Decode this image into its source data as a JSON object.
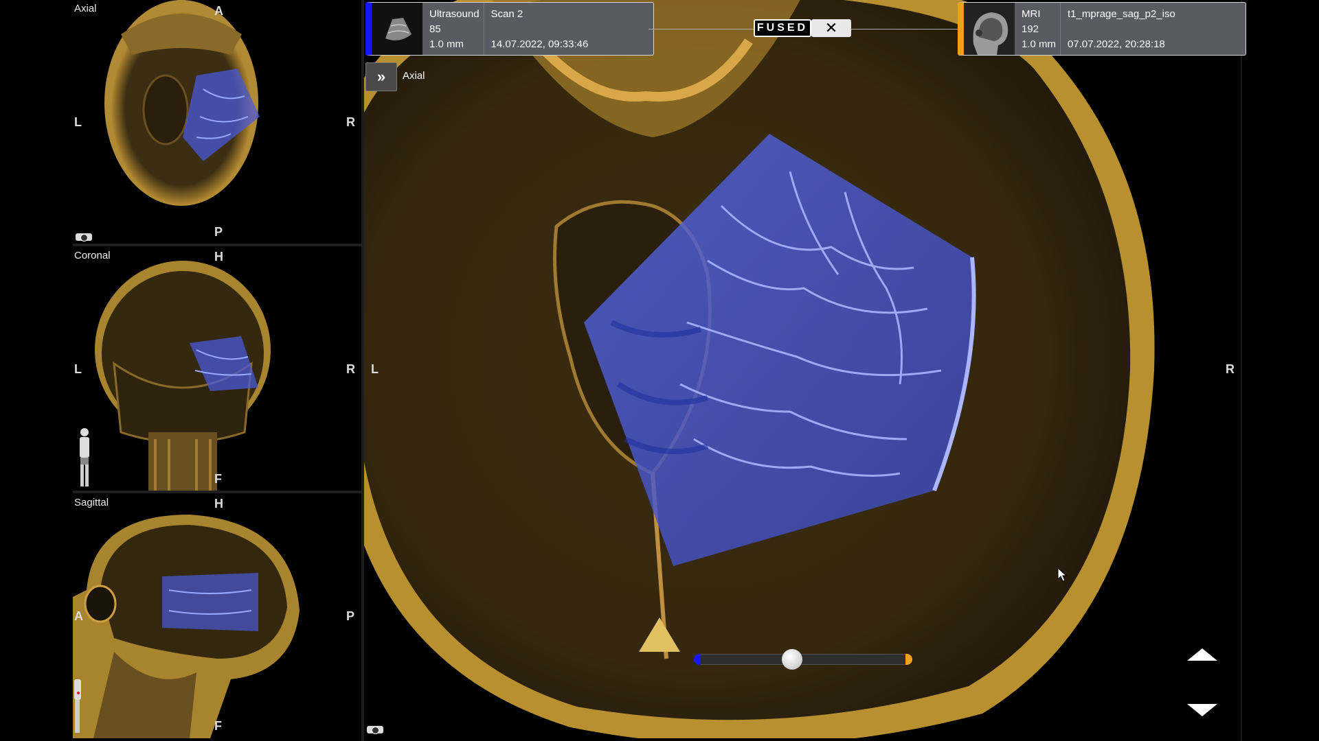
{
  "viewports": {
    "axial": {
      "title": "Axial",
      "top": "A",
      "bottom": "P",
      "left": "L",
      "right": "R"
    },
    "coronal": {
      "title": "Coronal",
      "top": "H",
      "bottom": "F",
      "left": "L",
      "right": "R"
    },
    "sagittal": {
      "title": "Sagittal",
      "top": "H",
      "bottom": "F",
      "left": "A",
      "right": "P"
    },
    "main": {
      "title": "Axial",
      "left": "L",
      "right": "R"
    }
  },
  "ultrasound_card": {
    "modality": "Ultrasound",
    "count": "85",
    "spacing": "1.0 mm",
    "name": "Scan 2",
    "datetime": "14.07.2022, 09:33:46",
    "accent_color": "#1616ff"
  },
  "mri_card": {
    "modality": "MRI",
    "count": "192",
    "spacing": "1.0 mm",
    "name": "t1_mprage_sag_p2_iso",
    "datetime": "07.07.2022, 20:28:18",
    "accent_color": "#f0a020"
  },
  "fusion": {
    "badge": "FUSED",
    "close_icon": "✕"
  },
  "expand_icon": "»",
  "blend_slider": {
    "value": 0.45
  },
  "icons": [
    "camera-icon",
    "body-figure-icon",
    "chevron-up-icon",
    "chevron-down-icon",
    "mouse-cursor-icon"
  ]
}
